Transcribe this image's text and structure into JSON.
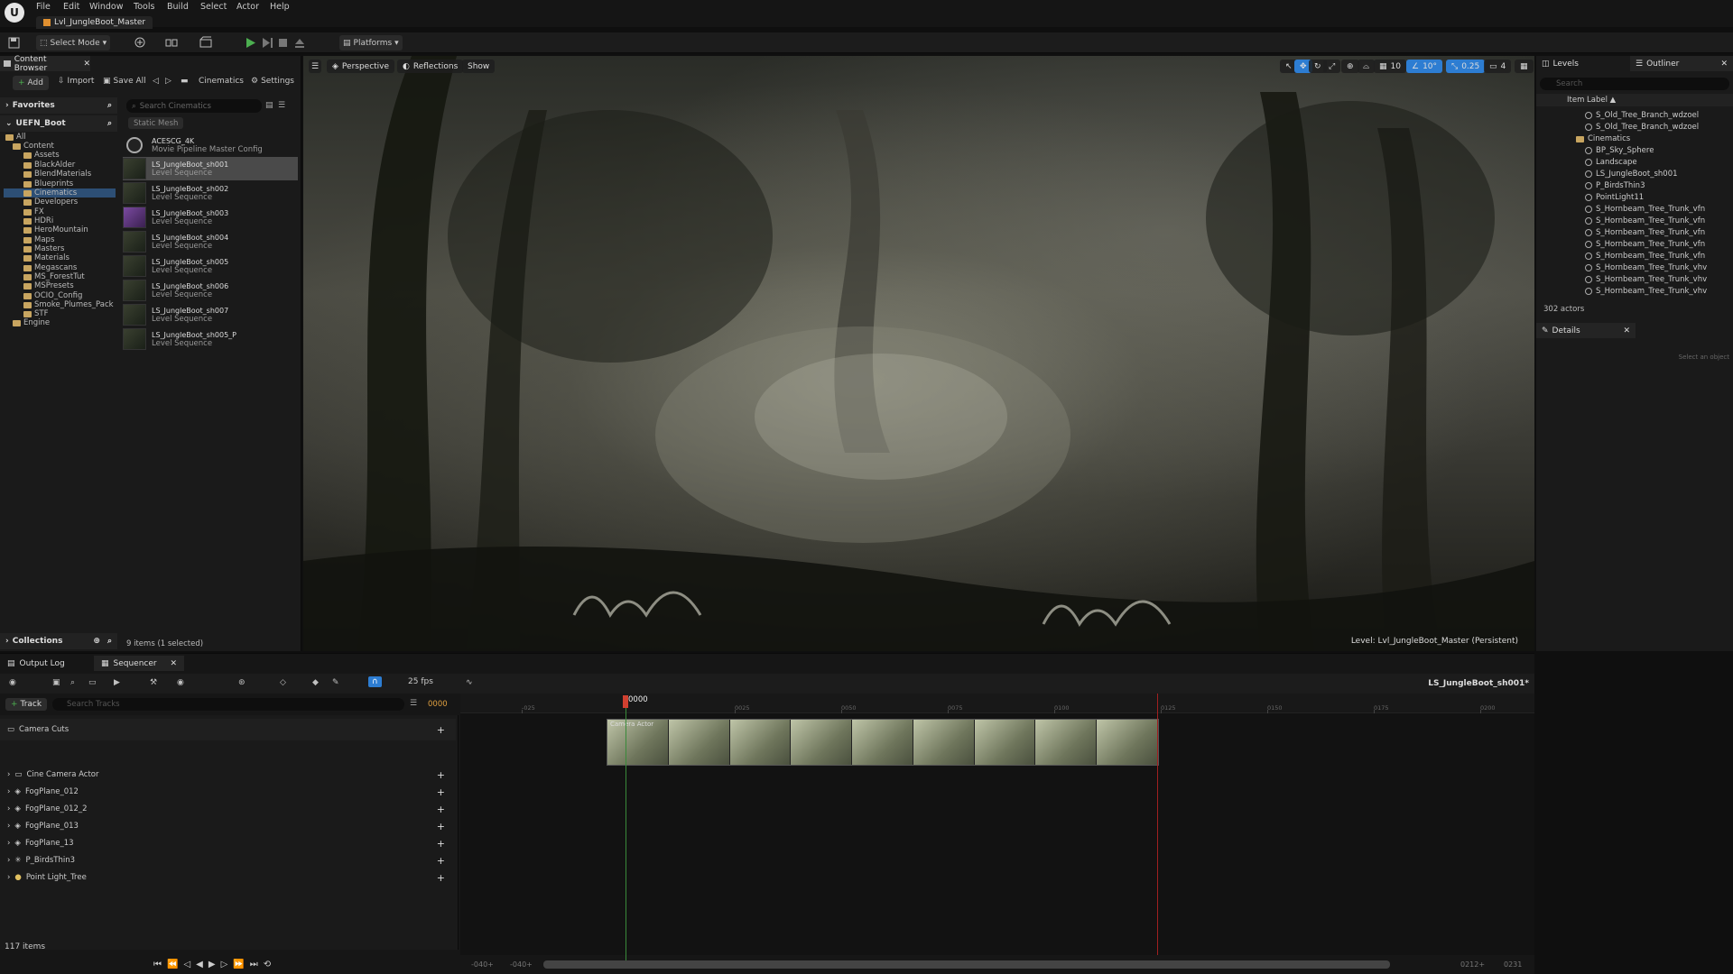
{
  "menu": [
    "File",
    "Edit",
    "Window",
    "Tools",
    "Build",
    "Select",
    "Actor",
    "Help"
  ],
  "logo": "U",
  "level_tab": "Lvl_JungleBoot_Master",
  "toolbar": {
    "select_mode": "Select Mode",
    "platforms": "Platforms"
  },
  "content_browser": {
    "tab": "Content Browser",
    "add": "Add",
    "import": "Import",
    "save_all": "Save All",
    "cinematics": "Cinematics",
    "settings": "Settings",
    "favorites": "Favorites",
    "project": "UEFN_Boot",
    "search_placeholder": "Search Cinematics",
    "filter_chip": "Static Mesh",
    "tree": [
      "All",
      "Content",
      "Assets",
      "BlackAlder",
      "BlendMaterials",
      "Blueprints",
      "Cinematics",
      "Developers",
      "FX",
      "HDRi",
      "HeroMountain",
      "Maps",
      "Masters",
      "Materials",
      "Megascans",
      "MS_ForestTut",
      "MSPresets",
      "OCIO_Config",
      "Smoke_Plumes_Pack",
      "STF",
      "Engine"
    ],
    "assets": [
      {
        "name": "ACESCG_4K",
        "type": "Movie Pipeline Master Config"
      },
      {
        "name": "LS_JungleBoot_sh001",
        "type": "Level Sequence"
      },
      {
        "name": "LS_JungleBoot_sh002",
        "type": "Level Sequence"
      },
      {
        "name": "LS_JungleBoot_sh003",
        "type": "Level Sequence"
      },
      {
        "name": "LS_JungleBoot_sh004",
        "type": "Level Sequence"
      },
      {
        "name": "LS_JungleBoot_sh005",
        "type": "Level Sequence"
      },
      {
        "name": "LS_JungleBoot_sh006",
        "type": "Level Sequence"
      },
      {
        "name": "LS_JungleBoot_sh007",
        "type": "Level Sequence"
      },
      {
        "name": "LS_JungleBoot_sh005_P",
        "type": "Level Sequence"
      }
    ],
    "collections": "Collections",
    "status": "9 items (1 selected)"
  },
  "viewport": {
    "perspective": "Perspective",
    "reflections": "Reflections",
    "show": "Show",
    "grid_value": "10",
    "angle_value": "10°",
    "scale_value": "0.25",
    "camera_speed": "4",
    "level_label": "Level: Lvl_JungleBoot_Master (Persistent)"
  },
  "right": {
    "levels_tab": "Levels",
    "outliner_tab": "Outliner",
    "search_placeholder": "Search",
    "column": "Item Label ▲",
    "items": [
      "S_Old_Tree_Branch_wdzoel",
      "S_Old_Tree_Branch_wdzoel",
      "Cinematics",
      "BP_Sky_Sphere",
      "Landscape",
      "LS_JungleBoot_sh001",
      "P_BirdsThin3",
      "PointLight11",
      "S_Hornbeam_Tree_Trunk_vfn",
      "S_Hornbeam_Tree_Trunk_vfn",
      "S_Hornbeam_Tree_Trunk_vfn",
      "S_Hornbeam_Tree_Trunk_vfn",
      "S_Hornbeam_Tree_Trunk_vfn",
      "S_Hornbeam_Tree_Trunk_vhv",
      "S_Hornbeam_Tree_Trunk_vhv",
      "S_Hornbeam_Tree_Trunk_vhv"
    ],
    "actor_count": "302 actors",
    "details_tab": "Details",
    "details_empty": "Select an object"
  },
  "sequencer": {
    "output_log_tab": "Output Log",
    "sequencer_tab": "Sequencer",
    "fps": "25 fps",
    "sequence_name": "LS_JungleBoot_sh001*",
    "track_button": "Track",
    "search_placeholder": "Search Tracks",
    "current_frame": "0000",
    "playhead_label": "0000",
    "tracks": [
      "Camera Cuts",
      "Cine Camera Actor",
      "FogPlane_012",
      "FogPlane_012_2",
      "FogPlane_013",
      "FogPlane_13",
      "P_BirdsThin3",
      "Point Light_Tree"
    ],
    "ticks": [
      "-025",
      "0025",
      "0050",
      "0075",
      "0100",
      "0125",
      "0150",
      "0175",
      "0200"
    ],
    "shot_label": "Camera Actor",
    "item_count": "117 items",
    "range_start": "-040+",
    "range_start2": "-040+",
    "range_end": "0212+",
    "range_end2": "0231"
  },
  "colors": {
    "accent_blue": "#2d7dd2",
    "play_green": "#4caf50",
    "playhead_red": "#d04030",
    "folder": "#c8a560"
  }
}
